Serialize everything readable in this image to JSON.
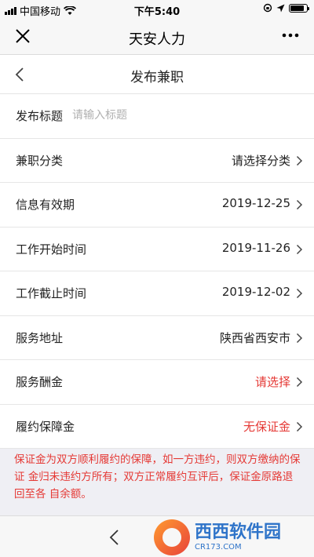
{
  "status_bar": {
    "carrier": "中国移动",
    "time": "下午5:40"
  },
  "wechat": {
    "title": "天安人力"
  },
  "header": {
    "title": "发布兼职"
  },
  "form": {
    "title_row": {
      "label": "发布标题",
      "placeholder": "请输入标题"
    },
    "rows": [
      {
        "label": "兼职分类",
        "value": "请选择分类"
      },
      {
        "label": "信息有效期",
        "value": "2019-12-25"
      },
      {
        "label": "工作开始时间",
        "value": "2019-11-26"
      },
      {
        "label": "工作截止时间",
        "value": "2019-12-02"
      },
      {
        "label": "服务地址",
        "value": "陕西省西安市"
      },
      {
        "label": "服务酬金",
        "value": "请选择"
      },
      {
        "label": "履约保障金",
        "value": "无保证金"
      }
    ]
  },
  "notice": "保证金为双方顺利履约的保障，如一方违约，则双方缴纳的保证 金归未违约方所有；双方正常履约互评后，保证金原路退回至各 自余额。",
  "watermark": {
    "main": "西西软件园",
    "sub": "CR173.COM"
  },
  "colors": {
    "accent_red": "#e53935",
    "background": "#efeff4"
  }
}
